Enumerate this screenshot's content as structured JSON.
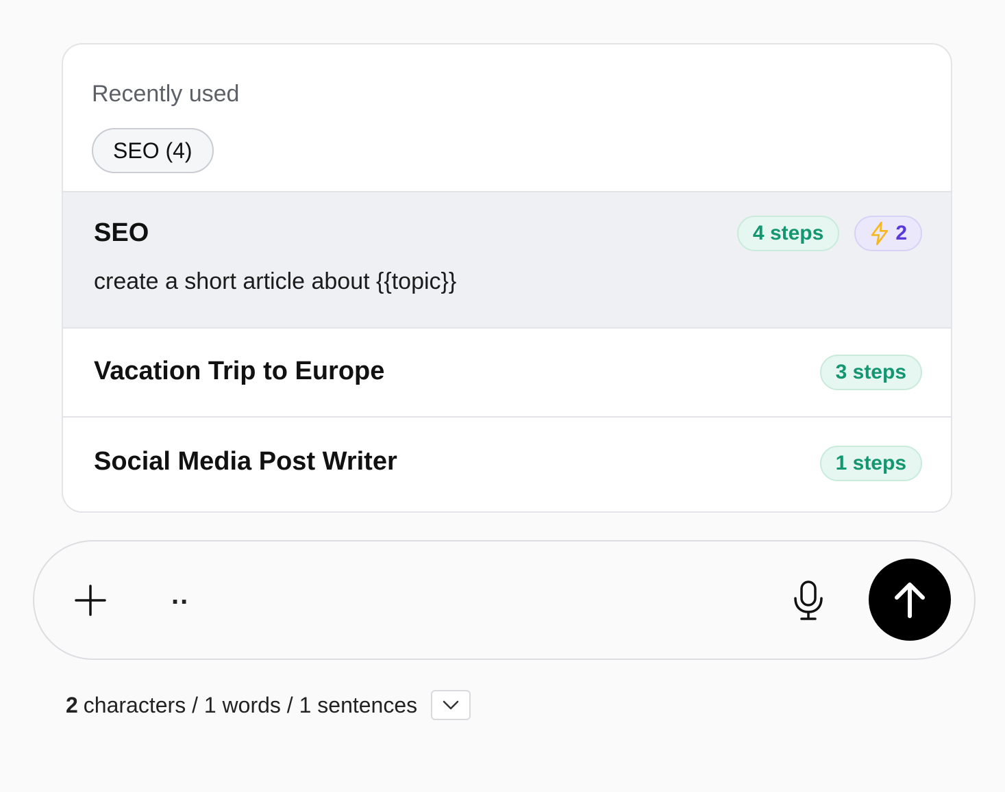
{
  "recent": {
    "title": "Recently used",
    "chip_label": "SEO (4)"
  },
  "workflows": [
    {
      "title": "SEO",
      "description": "create a short article about {{topic}}",
      "steps_label": "4 steps",
      "bolt_count": "2",
      "active": true
    },
    {
      "title": "Vacation Trip to Europe",
      "steps_label": "3 steps"
    },
    {
      "title": "Social Media Post Writer",
      "steps_label": "1 steps"
    }
  ],
  "composer": {
    "input_value": ".."
  },
  "stats": {
    "char_count": "2",
    "rest": "characters / 1 words / 1 sentences"
  },
  "icons": {
    "plus": "plus-icon",
    "mic": "microphone-icon",
    "send": "arrow-up-icon",
    "bolt": "lightning-icon",
    "chevron": "chevron-down-icon"
  },
  "colors": {
    "steps_badge_text": "#149670",
    "bolt_badge_text": "#5a3ad8",
    "bolt_icon": "#f5b820",
    "send_button": "#000000"
  }
}
